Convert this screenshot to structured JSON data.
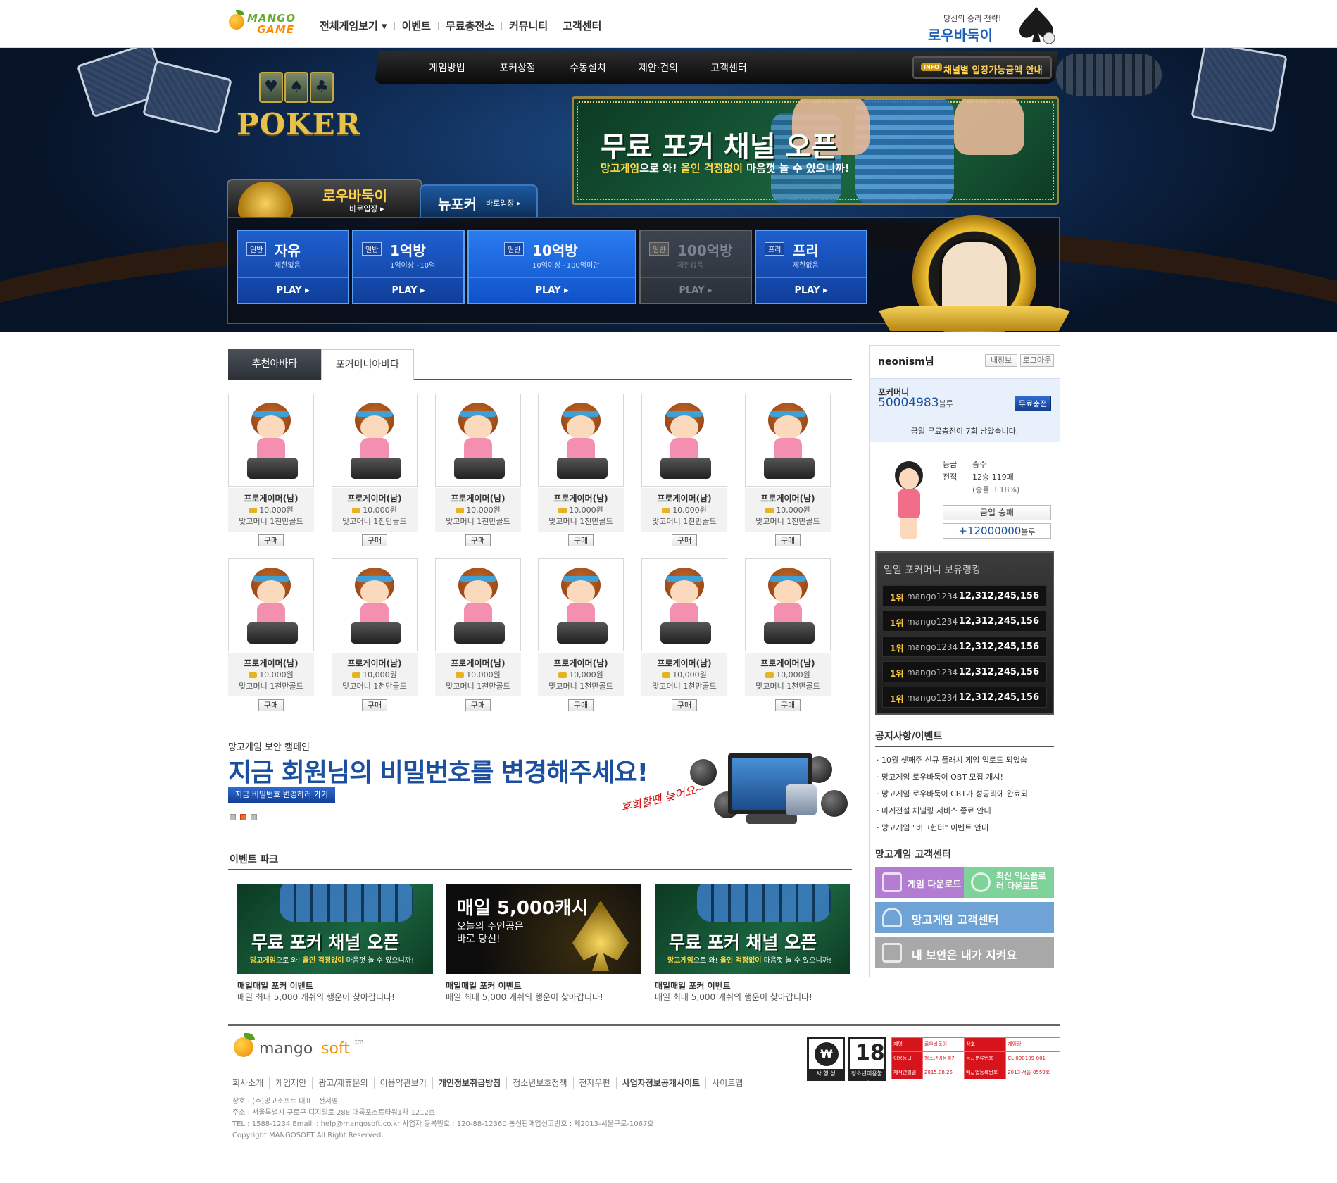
{
  "top": {
    "logo_line1": "MANGO",
    "logo_line2": "GAME",
    "nav": [
      "전체게임보기",
      "이벤트",
      "무료충전소",
      "커뮤니티",
      "고객센터"
    ],
    "badge_slogan": "당신의 승리 전략!",
    "badge_name": "로우바둑이"
  },
  "hero": {
    "poker_word": "POKER",
    "subnav": [
      "게임방법",
      "포커상점",
      "수동설치",
      "제안·건의",
      "고객센터"
    ],
    "info_tag": "INFO",
    "info_text": "채널별 입장가능금액 안내",
    "banner_title": "무료 포커 채널 오픈",
    "banner_sub_a": "망고게임",
    "banner_sub_b": "으로 와! ",
    "banner_sub_c": "올인 걱정없이",
    "banner_sub_d": " 마음껏 놀 수 있으니까!",
    "tab_low_name": "로우바둑이",
    "tab_low_enter": "바로입장 ▸",
    "tab_new_name": "뉴포커",
    "tab_new_enter": "바로입장 ▸",
    "rooms": [
      {
        "badge": "일반",
        "title": "자유",
        "cond": "제한없음",
        "play": "PLAY ▸"
      },
      {
        "badge": "일반",
        "title": "1억방",
        "cond": "1억이상~10억",
        "play": "PLAY ▸"
      },
      {
        "badge": "일반",
        "title": "10억방",
        "cond": "10억이상~100억미만",
        "play": "PLAY ▸"
      },
      {
        "badge": "일반",
        "title": "100억방",
        "cond": "제한없음",
        "play": "PLAY ▸"
      },
      {
        "badge": "프리",
        "title": "프리",
        "cond": "제한없음",
        "play": "PLAY ▸"
      }
    ]
  },
  "avatar_tabs": [
    "추천아바타",
    "포커머니아바타"
  ],
  "items": {
    "name": "프로게이머(남)",
    "price": "10,000원",
    "bonus": "맞고머니 1천만골드",
    "buy": "구매"
  },
  "campaign": {
    "small": "망고게임 보안 캠페인",
    "big": "지금 회원님의 비밀번호를 변경해주세요!",
    "button": "지금 비밀번호 변경하러 가기",
    "script": "후회할땐 늦어요~"
  },
  "events": {
    "title": "이벤트 파크",
    "list": [
      {
        "hd": "무료 포커 채널 오픈",
        "t": "매일매일 포커 이벤트",
        "d": "매일 최대 5,000 캐쉬의 행운이 찾아갑니다!"
      },
      {
        "hd": "매일 5,000캐시",
        "hd2": "오늘의 주인공은\n바로 당신!",
        "t": "매일매일 포커 이벤트",
        "d": "매일 최대 5,000 캐쉬의 행운이 찾아갑니다!"
      },
      {
        "hd": "무료 포커 채널 오픈",
        "t": "매일매일 포커 이벤트",
        "d": "매일 최대 5,000 캐쉬의 행운이 찾아갑니다!"
      }
    ],
    "banner_sub_a": "망고게임",
    "banner_sub_b": "으로 와! ",
    "banner_sub_c": "올인 걱정없이",
    "banner_sub_d": " 마음껏 놀 수 있으니까!"
  },
  "side": {
    "user": "neonism님",
    "myinfo": "내정보",
    "logout": "로그아웃",
    "money_label": "포커머니",
    "money_value": "50004983",
    "money_unit": "블루",
    "charge": "무료충전",
    "note": "금일 무료충전이 7회 남았습니다.",
    "grade_k": "등급",
    "grade_v": "중수",
    "record_k": "전적",
    "record_v": "12승 119패",
    "record_rate": "(승률 3.18%)",
    "today_btn": "금일 승패",
    "today_val": "+12000000",
    "today_unit": "블루",
    "rank_title": "일일 포커머니 보유랭킹",
    "ranks": [
      {
        "pos": "1위",
        "id": "mango1234",
        "pt": "12,312,245,156"
      },
      {
        "pos": "1위",
        "id": "mango1234",
        "pt": "12,312,245,156"
      },
      {
        "pos": "1위",
        "id": "mango1234",
        "pt": "12,312,245,156"
      },
      {
        "pos": "1위",
        "id": "mango1234",
        "pt": "12,312,245,156"
      },
      {
        "pos": "1위",
        "id": "mango1234",
        "pt": "12,312,245,156"
      }
    ],
    "notice_title": "공지사항/이벤트",
    "notices": [
      "· 10월 셋째주 신규 플래시 게임 업로드 되었습",
      "· 망고게임 로우바둑이 OBT 모집 개시!",
      "· 망고게임 로우바둑이 CBT가 성공리에 완료되",
      "· 마계전설 채널링 서비스 종료 안내",
      "· 망고게임 \"버그헌터\" 이벤트 안내"
    ],
    "cs_title": "망고게임 고객센터",
    "cs_download": "게임 다운로드",
    "cs_ie": "최신 익스플로러 다운로드",
    "cs_center": "망고게임 고객센터",
    "cs_security": "내 보안은 내가 지켜요"
  },
  "footer": {
    "logo_a": "mango",
    "logo_b": "soft",
    "logo_tm": "tm",
    "links": [
      "회사소개",
      "게임제안",
      "광고/제휴문의",
      "이용약관보기",
      "개인정보취급방침",
      "청소년보호정책",
      "전자우편",
      "사업자정보공개사이트",
      "사이트맵"
    ],
    "addr1": "상호 : (주)망고소프트 대표 : 전서영",
    "addr2": "주소 : 서울특별시 구로구 디지털로 288 대륭포스트타워1차 1212호",
    "addr3": "TEL : 1588-1234 Emaill : help@mangosoft.co.kr 사업자 등록번호 : 120-88-12360 통신판매업신고번호 : 제2013-서울구로-1067호",
    "addr4": "Copyright MANGOSOFT All Right Reserved.",
    "badge1_cap": "사 행 성",
    "badge2_num": "18",
    "badge2_cap": "청소년이용불가",
    "grade_rows": [
      [
        "제명",
        "로우바둑이",
        "상호",
        "게임랑"
      ],
      [
        "이용등급",
        "청소년이용불가",
        "등급분류번호",
        "CL-090109-001"
      ],
      [
        "제작연월일",
        "2015.08.25",
        "배급업등록번호",
        "2013-서울-0559호"
      ]
    ]
  },
  "colors": {
    "accent": "#1b4fa0",
    "gold": "#ffd24a",
    "danger": "#d7141b"
  }
}
